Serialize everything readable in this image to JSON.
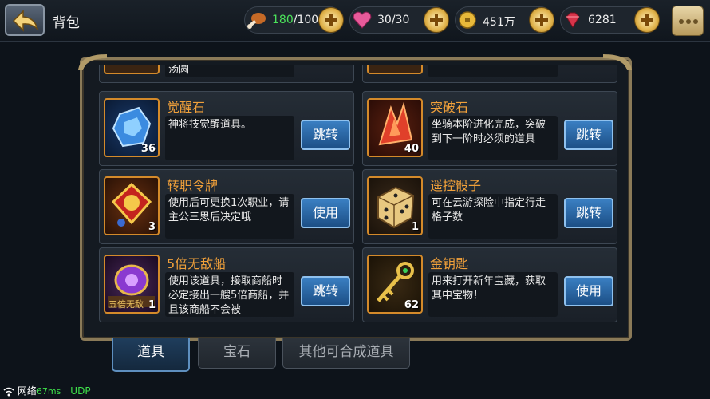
{
  "header": {
    "title": "背包",
    "stamina": {
      "current": "180",
      "sep_max": "/100"
    },
    "hearts": "30/30",
    "gold": "451万",
    "gems": "6281"
  },
  "items": [
    {
      "name": "觉醒石",
      "count": "36",
      "desc": "神将技觉醒道具。",
      "action": "跳转"
    },
    {
      "name": "突破石",
      "count": "40",
      "desc": "坐骑本阶进化完成，突破到下一阶时必须的道具",
      "action": "跳转"
    },
    {
      "name": "转职令牌",
      "count": "3",
      "desc": "使用后可更换1次职业，请主公三思后决定哦",
      "action": "使用"
    },
    {
      "name": "遥控骰子",
      "count": "1",
      "desc": "可在云游探险中指定行走格子数",
      "action": "跳转"
    },
    {
      "name": "5倍无敌船",
      "count": "1",
      "desc": "使用该道具，接取商船时必定接出一艘5倍商船，并且该商船不会被",
      "action": "跳转"
    },
    {
      "name": "金钥匙",
      "count": "62",
      "desc": "用来打开新年宝藏，获取其中宝物！",
      "action": "使用"
    }
  ],
  "partial_top": {
    "left_desc": "汤圆"
  },
  "tabs": [
    "道具",
    "宝石",
    "其他可合成道具"
  ],
  "status": {
    "network": "网络",
    "ping": "67ms",
    "proto": "UDP"
  },
  "icon_text": {
    "ship_banner": "五倍无敌"
  }
}
